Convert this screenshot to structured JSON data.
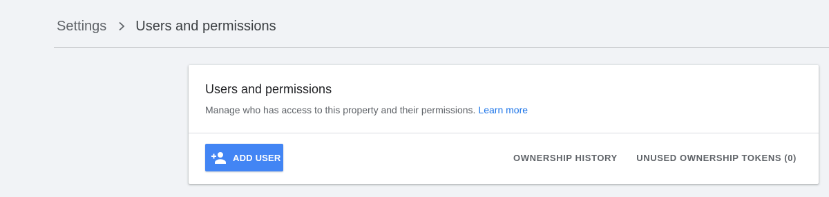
{
  "breadcrumb": {
    "root": "Settings",
    "current": "Users and permissions",
    "separator_icon": "chevron-right-icon"
  },
  "card": {
    "title": "Users and permissions",
    "description": "Manage who has access to this property and their permissions.",
    "learn_more": "Learn more",
    "actions": {
      "add_user_label": "ADD USER",
      "add_user_icon": "person-add-icon",
      "ownership_history_label": "OWNERSHIP HISTORY",
      "unused_tokens_label": "UNUSED OWNERSHIP TOKENS (0)"
    }
  },
  "colors": {
    "background": "#f1f3f6",
    "card": "#ffffff",
    "primary_button": "#4285f4",
    "link": "#1a73e8",
    "secondary_text": "#5f6368"
  }
}
